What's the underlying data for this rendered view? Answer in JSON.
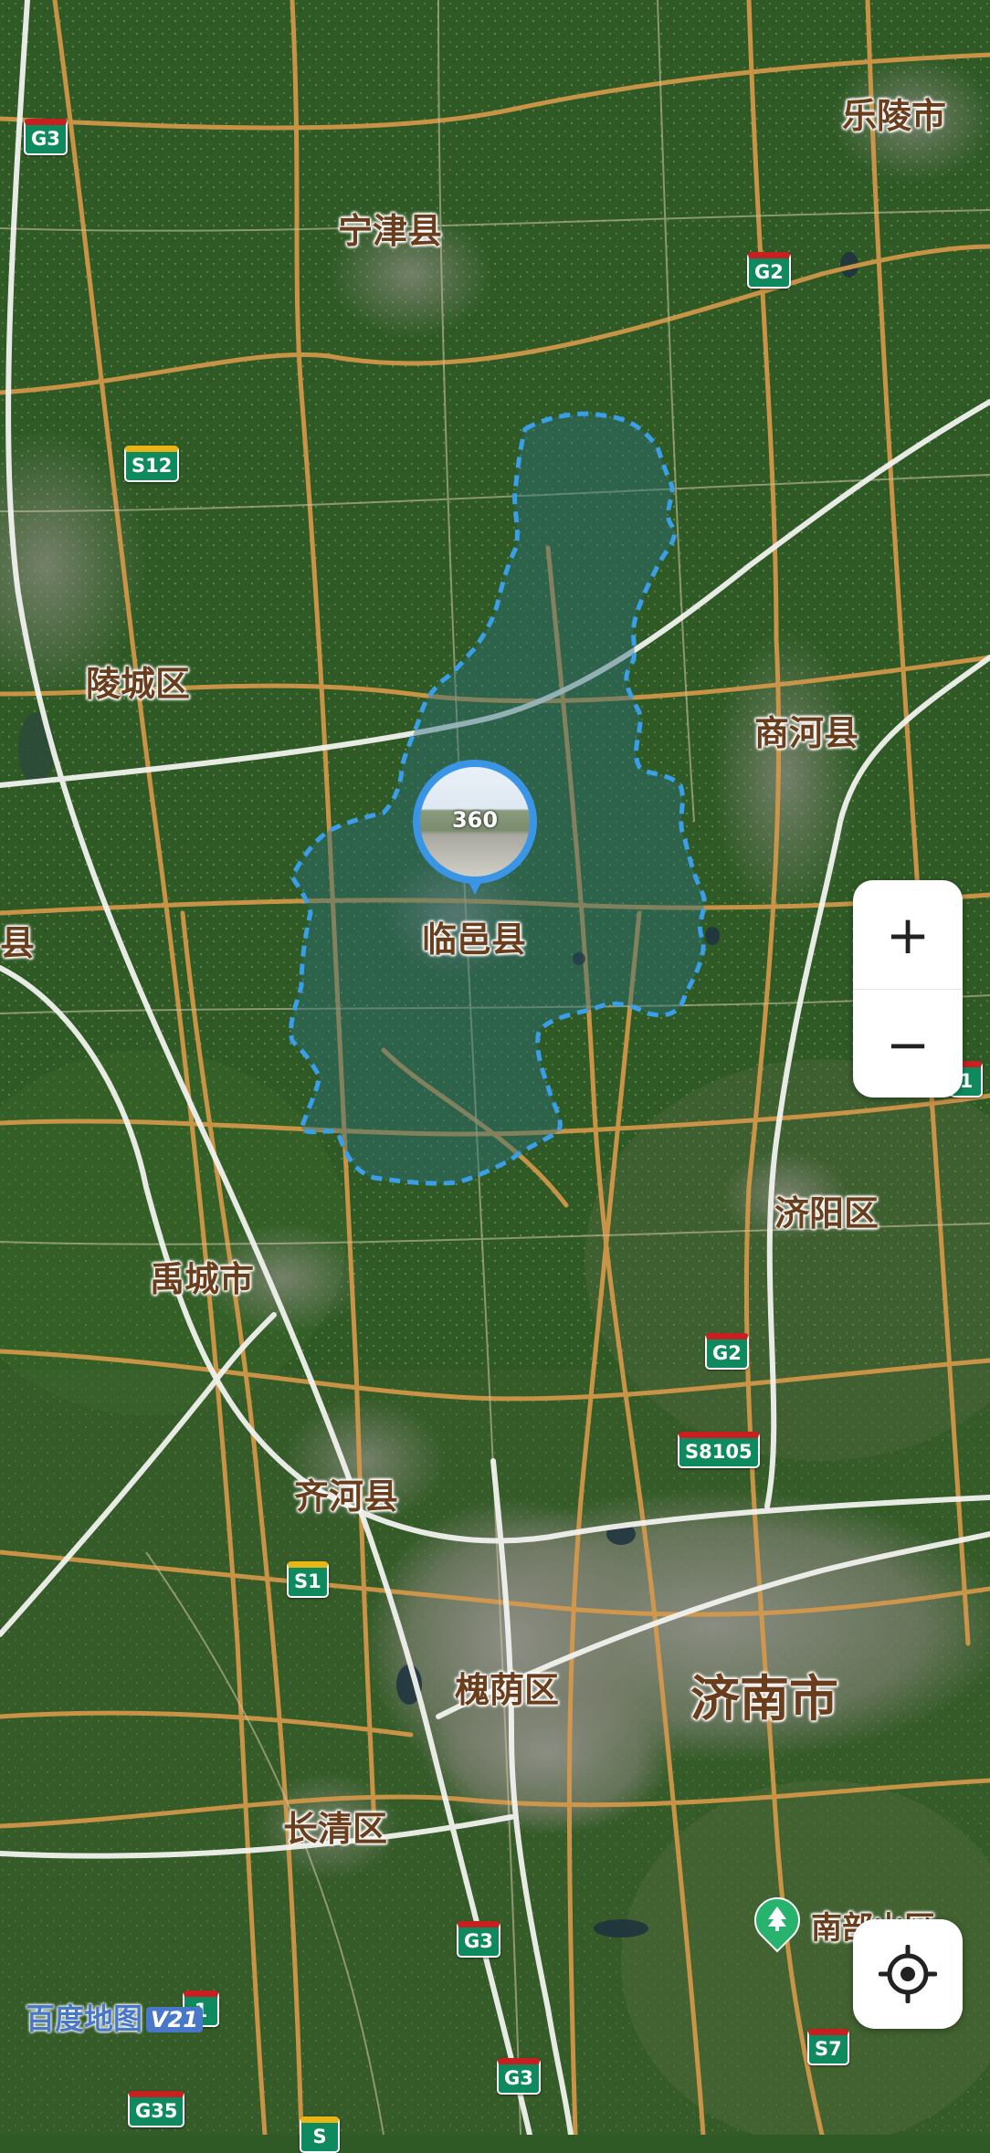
{
  "map": {
    "place_labels": {
      "leling": "乐陵市",
      "ningjin": "宁津县",
      "lingcheng": "陵城区",
      "shanghe": "商河县",
      "linyi": "临邑县",
      "edge_left": "县",
      "jiyang": "济阳区",
      "yucheng": "禹城市",
      "qihe": "齐河县",
      "huaiyin": "槐荫区",
      "jinan": "济南市",
      "changqing": "长清区",
      "nanbushan": "南部山区"
    },
    "road_shields": {
      "g3_top": "G3",
      "g2_top": "G2",
      "s12": "S12",
      "g2_mid": "G2",
      "s8105": "S8105",
      "s1": "S1",
      "g3_bottom1": "G3",
      "g3_bottom2": "G3",
      "s7": "S7",
      "g35": "G35",
      "edge_right": "1",
      "edge_bottom_left": "1",
      "edge_bottom": "S"
    },
    "panorama_label": "360",
    "colors": {
      "boundary": "#3a9ee8",
      "highway_orange": "#d99a4a",
      "expressway_white": "#f2f2ef",
      "satellite_green": "#2f5a26",
      "panorama_blue": "#3b95e6"
    }
  },
  "controls": {
    "zoom_in_label": "+",
    "zoom_out_label": "−",
    "locate_icon": "locate-crosshair-icon"
  },
  "branding": {
    "logo_text": "百度地图",
    "logo_version": "V21"
  }
}
